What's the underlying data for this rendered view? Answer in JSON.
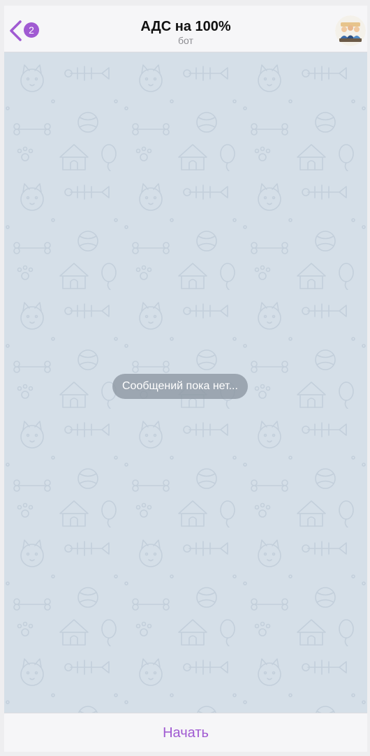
{
  "header": {
    "back_icon": "chevron-left-icon",
    "unread_count": "2",
    "title": "АДС на 100%",
    "subtitle": "бот",
    "avatar_icon": "group-avatar-icon"
  },
  "chat": {
    "background_pattern": "doodle-pets-pattern",
    "empty_message": "Сообщений пока нет..."
  },
  "bottom": {
    "start_label": "Начать"
  },
  "colors": {
    "accent": "#a05ad2",
    "chat_background": "#d5dfe8",
    "bar_background": "#f6f6f8",
    "pill_background": "#8c96a2"
  }
}
